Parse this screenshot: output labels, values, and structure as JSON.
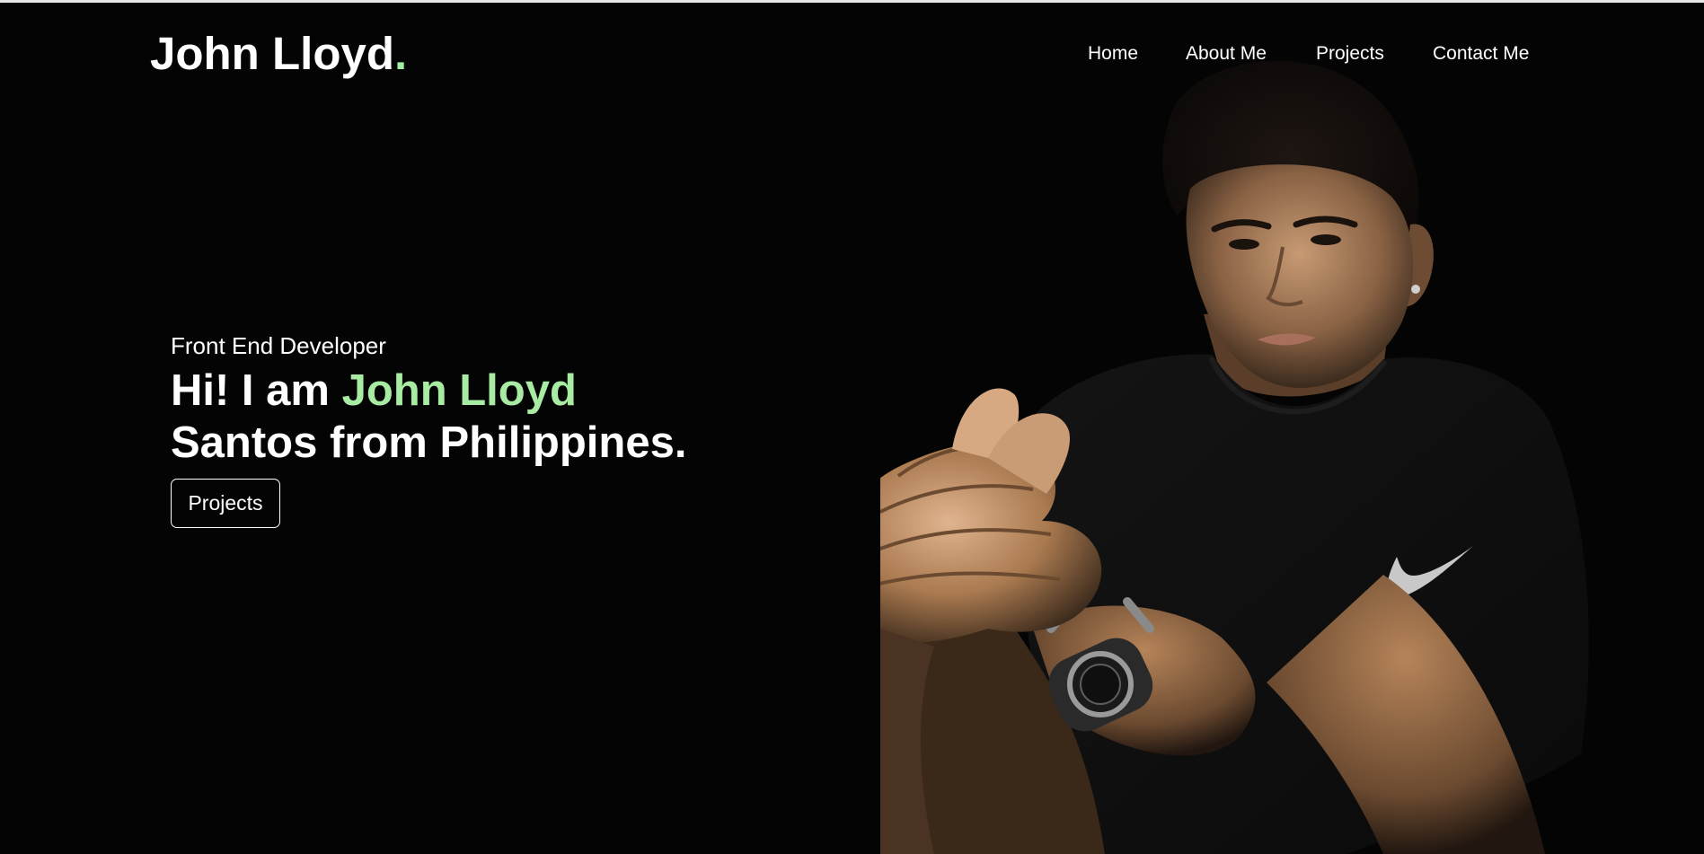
{
  "header": {
    "logo_text": "John Lloyd",
    "logo_dot": "."
  },
  "nav": {
    "items": [
      {
        "label": "Home"
      },
      {
        "label": "About Me"
      },
      {
        "label": "Projects"
      },
      {
        "label": "Contact Me"
      }
    ]
  },
  "hero": {
    "subtitle": "Front End Developer",
    "title_prefix": "Hi! I am ",
    "title_name": "John Lloyd",
    "title_line2": "Santos from Philippines.",
    "button_label": "Projects"
  },
  "colors": {
    "background": "#040404",
    "accent": "#a8eca4",
    "text": "#ffffff"
  },
  "icons": {
    "portrait": "person-photo"
  }
}
